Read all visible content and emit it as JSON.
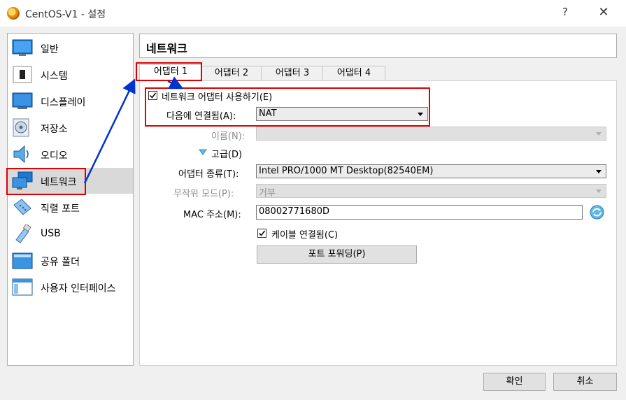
{
  "window": {
    "title": "CentOS-V1 - 설정",
    "help": "?",
    "close": "✕"
  },
  "sidebar": {
    "items": [
      {
        "label": "일반",
        "icon": "general-icon"
      },
      {
        "label": "시스템",
        "icon": "system-icon"
      },
      {
        "label": "디스플레이",
        "icon": "display-icon"
      },
      {
        "label": "저장소",
        "icon": "storage-icon"
      },
      {
        "label": "오디오",
        "icon": "audio-icon"
      },
      {
        "label": "네트워크",
        "icon": "network-icon",
        "selected": true
      },
      {
        "label": "직렬 포트",
        "icon": "serial-port-icon"
      },
      {
        "label": "USB",
        "icon": "usb-icon"
      },
      {
        "label": "공유 폴더",
        "icon": "shared-folder-icon"
      },
      {
        "label": "사용자 인터페이스",
        "icon": "user-interface-icon"
      }
    ]
  },
  "header": {
    "title": "네트워크"
  },
  "tabs": [
    {
      "label": "어댑터 1",
      "active": true
    },
    {
      "label": "어댑터 2"
    },
    {
      "label": "어댑터 3"
    },
    {
      "label": "어댑터 4"
    }
  ],
  "form": {
    "enable_adapter": {
      "label": "네트워크 어댑터 사용하기(E)",
      "checked": true
    },
    "attached_to": {
      "label": "다음에 연결됨(A):",
      "value": "NAT"
    },
    "name": {
      "label": "이름(N):",
      "value": ""
    },
    "advanced": {
      "label": "고급(D)"
    },
    "adapter_type": {
      "label": "어댑터 종류(T):",
      "value": "Intel PRO/1000 MT Desktop(82540EM)"
    },
    "promiscuous": {
      "label": "무작위 모드(P):",
      "value": "거부"
    },
    "mac": {
      "label": "MAC 주소(M):",
      "value": "08002771680D"
    },
    "cable": {
      "label": "케이블 연결됨(C)",
      "checked": true
    },
    "port_forwarding": {
      "label": "포트 포워딩(P)"
    }
  },
  "footer": {
    "ok": "확인",
    "cancel": "취소"
  },
  "colors": {
    "annotation_red": "#e00000",
    "annotation_blue": "#0033cc",
    "selected_bg": "#d9d9d9"
  }
}
